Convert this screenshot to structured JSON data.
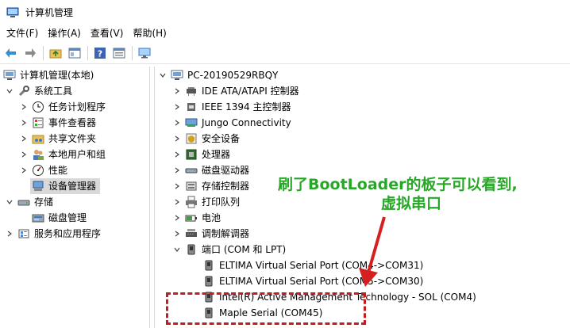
{
  "window": {
    "title": "计算机管理"
  },
  "menu": [
    "文件(F)",
    "操作(A)",
    "查看(V)",
    "帮助(H)"
  ],
  "left_tree": [
    {
      "label": "计算机管理(本地)",
      "icon": "computer-management-icon",
      "level": 0,
      "expander": "none"
    },
    {
      "label": "系统工具",
      "icon": "tools-icon",
      "level": 1,
      "expander": "expanded"
    },
    {
      "label": "任务计划程序",
      "icon": "clock-icon",
      "level": 2,
      "expander": "collapsed"
    },
    {
      "label": "事件查看器",
      "icon": "event-viewer-icon",
      "level": 2,
      "expander": "collapsed"
    },
    {
      "label": "共享文件夹",
      "icon": "shared-folder-icon",
      "level": 2,
      "expander": "collapsed"
    },
    {
      "label": "本地用户和组",
      "icon": "users-icon",
      "level": 2,
      "expander": "collapsed"
    },
    {
      "label": "性能",
      "icon": "performance-icon",
      "level": 2,
      "expander": "collapsed"
    },
    {
      "label": "设备管理器",
      "icon": "device-manager-icon",
      "level": 2,
      "expander": "none",
      "selected": true
    },
    {
      "label": "存储",
      "icon": "storage-icon",
      "level": 1,
      "expander": "expanded"
    },
    {
      "label": "磁盘管理",
      "icon": "disk-management-icon",
      "level": 2,
      "expander": "none"
    },
    {
      "label": "服务和应用程序",
      "icon": "services-icon",
      "level": 1,
      "expander": "collapsed"
    }
  ],
  "device_tree": {
    "root": "PC-20190529RBQY",
    "categories": [
      {
        "label": "IDE ATA/ATAPI 控制器",
        "icon": "ide-controller-icon",
        "expander": "collapsed"
      },
      {
        "label": "IEEE 1394 主控制器",
        "icon": "ieee1394-icon",
        "expander": "collapsed"
      },
      {
        "label": "Jungo Connectivity",
        "icon": "jungo-icon",
        "expander": "collapsed"
      },
      {
        "label": "安全设备",
        "icon": "security-device-icon",
        "expander": "collapsed"
      },
      {
        "label": "处理器",
        "icon": "processor-icon",
        "expander": "collapsed"
      },
      {
        "label": "磁盘驱动器",
        "icon": "disk-drive-icon",
        "expander": "collapsed"
      },
      {
        "label": "存储控制器",
        "icon": "storage-controller-icon",
        "expander": "collapsed"
      },
      {
        "label": "打印队列",
        "icon": "print-queue-icon",
        "expander": "collapsed"
      },
      {
        "label": "电池",
        "icon": "battery-icon",
        "expander": "collapsed"
      },
      {
        "label": "调制解调器",
        "icon": "modem-icon",
        "expander": "collapsed"
      },
      {
        "label": "端口 (COM 和 LPT)",
        "icon": "port-icon",
        "expander": "expanded"
      }
    ],
    "ports": [
      "ELTIMA Virtual Serial Port (COM4->COM31)",
      "ELTIMA Virtual Serial Port (COM5->COM30)",
      "Intel(R) Active Management Technology - SOL (COM4)",
      "Maple Serial (COM45)"
    ]
  },
  "annotation": {
    "line1": "刷了BootLoader的板子可以看到,",
    "line2": "虚拟串口",
    "color": "#26a826",
    "highlight_color": "#c21e1e"
  }
}
